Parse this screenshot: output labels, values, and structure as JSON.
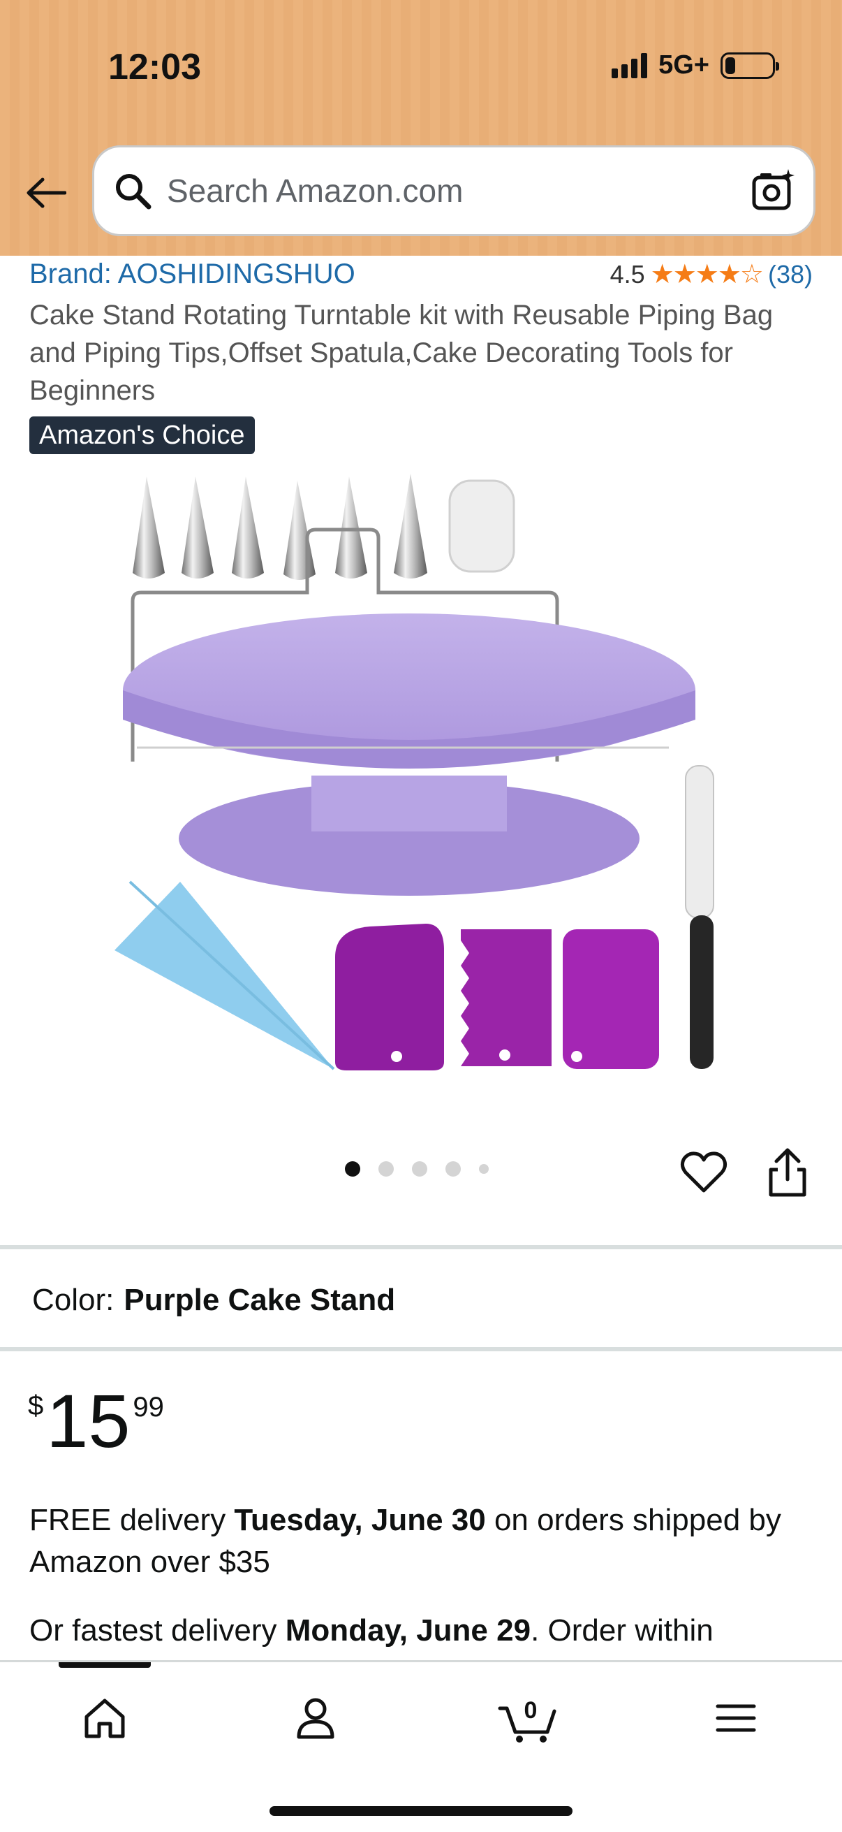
{
  "status_bar": {
    "time": "12:03",
    "network": "5G+",
    "battery_percent": 15
  },
  "search": {
    "placeholder": "Search Amazon.com"
  },
  "product": {
    "brand": "Brand: AOSHIDINGSHUO",
    "rating": "4.5",
    "stars": "★★★★☆",
    "rating_count": "(38)",
    "title": "Cake Stand Rotating Turntable kit with Reusable Piping Bag and Piping Tips,Offset Spatula,Cake Decorating Tools for Beginners",
    "badge": "Amazon's Choice",
    "image_count": 5,
    "current_image": 1
  },
  "color": {
    "label": "Color:",
    "value": "Purple Cake Stand"
  },
  "price": {
    "symbol": "$",
    "whole": "15",
    "fraction": "99"
  },
  "delivery": {
    "prefix": "FREE delivery ",
    "date": "Tuesday, June 30",
    "suffix": " on orders shipped by Amazon over $35"
  },
  "fastest": {
    "prefix": "Or fastest delivery ",
    "date": "Monday, June 29",
    "suffix": ". Order within"
  },
  "nav": {
    "cart_count": "0",
    "items": [
      "home-icon",
      "account-icon",
      "cart-icon",
      "menu-icon"
    ],
    "active": "home"
  },
  "colors": {
    "header": "#ebb37c",
    "link": "#1e6aa8",
    "star": "#f57c16",
    "badge_bg": "#232f3e",
    "product_purple": "#b19ae0"
  }
}
